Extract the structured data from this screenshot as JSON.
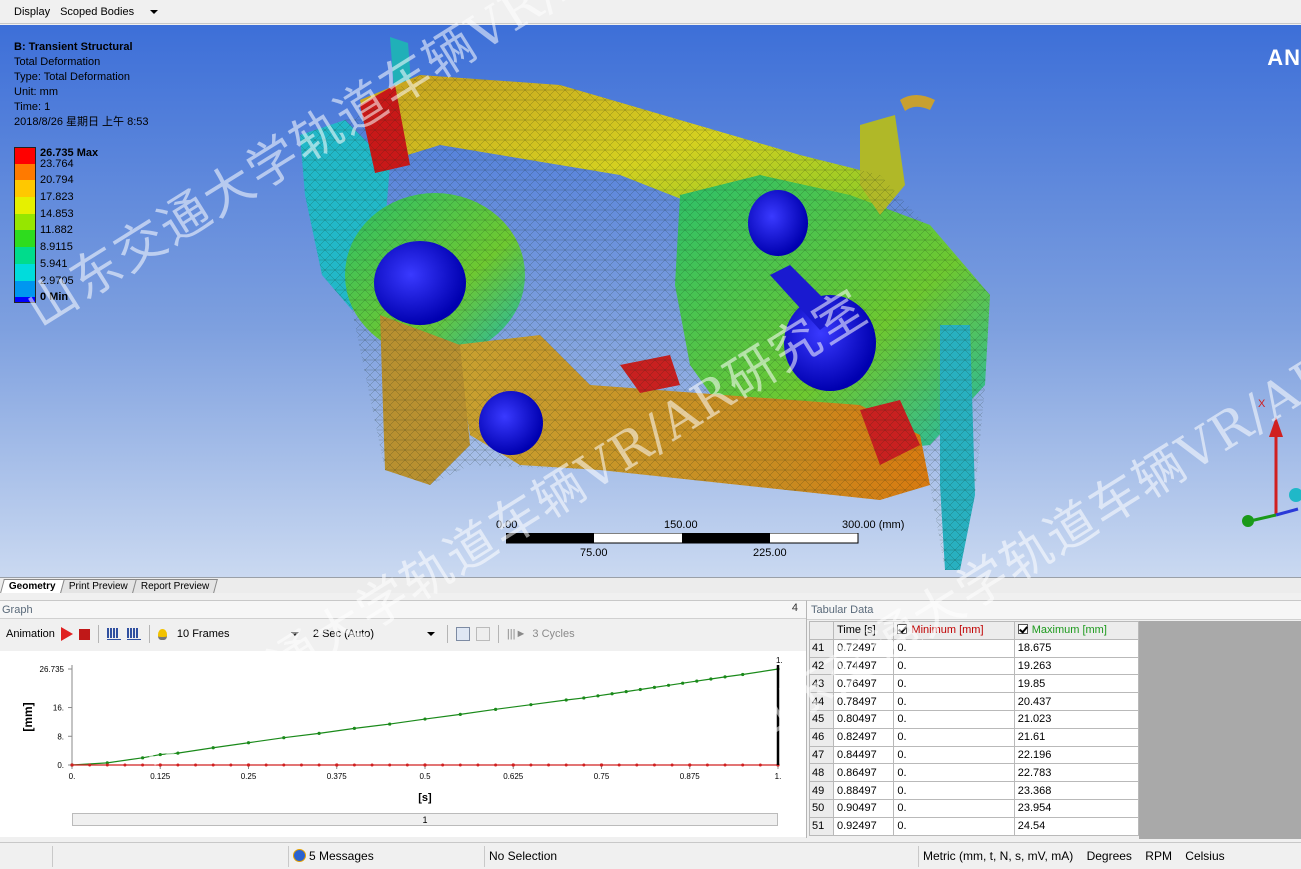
{
  "toolbar": {
    "display_label": "Display",
    "display_value": "Scoped Bodies"
  },
  "result": {
    "title": "B: Transient Structural",
    "lines": [
      "Total Deformation",
      "Type: Total Deformation",
      "Unit: mm",
      "Time: 1",
      "2018/8/26 星期日 上午 8:53"
    ]
  },
  "legend": {
    "entries": [
      {
        "label": "26.735 Max",
        "color": "#ff0000",
        "bold": true
      },
      {
        "label": "23.764",
        "color": "#ff7a00",
        "bold": false
      },
      {
        "label": "20.794",
        "color": "#ffc800",
        "bold": false
      },
      {
        "label": "17.823",
        "color": "#e6f000",
        "bold": false
      },
      {
        "label": "14.853",
        "color": "#96e600",
        "bold": false
      },
      {
        "label": "11.882",
        "color": "#2edc1e",
        "bold": false
      },
      {
        "label": "8.9115",
        "color": "#00dc8c",
        "bold": false
      },
      {
        "label": "5.941",
        "color": "#00dcdc",
        "bold": false
      },
      {
        "label": "2.9705",
        "color": "#0096f0",
        "bold": false
      },
      {
        "label": "0 Min",
        "color": "#0000ff",
        "bold": true
      }
    ]
  },
  "brand": "AN",
  "scale": {
    "top_left": "0.00",
    "top_mid": "150.00",
    "top_right": "300.00 (mm)",
    "bottom_left": "75.00",
    "bottom_right": "225.00"
  },
  "triad": {
    "x_label": "X"
  },
  "tabs": [
    {
      "label": "Geometry",
      "active": true
    },
    {
      "label": "Print Preview",
      "active": false
    },
    {
      "label": "Report Preview",
      "active": false
    }
  ],
  "graph": {
    "title": "Graph",
    "pin": "4",
    "animation_label": "Animation",
    "frames": "10 Frames",
    "duration": "2 Sec (Auto)",
    "cycles": "3 Cycles",
    "slider_label": "1"
  },
  "chart_data": {
    "type": "line",
    "title": "",
    "xlabel": "[s]",
    "ylabel": "[mm]",
    "xlim": [
      0,
      1
    ],
    "ylim": [
      0,
      26.735
    ],
    "x_ticks": [
      "0.",
      "0.125",
      "0.25",
      "0.375",
      "0.5",
      "0.625",
      "0.75",
      "0.875",
      "1."
    ],
    "y_ticks": [
      {
        "value": 0,
        "label": "0."
      },
      {
        "value": 8,
        "label": "8."
      },
      {
        "value": 16,
        "label": "16."
      },
      {
        "value": 26.735,
        "label": "26.735"
      }
    ],
    "cursor_label": "1.",
    "series": [
      {
        "color": "#1a8a1a",
        "x": [
          0,
          0.05,
          0.1,
          0.125,
          0.15,
          0.2,
          0.25,
          0.3,
          0.35,
          0.4,
          0.45,
          0.5,
          0.55,
          0.6,
          0.65,
          0.7,
          0.72497,
          0.74497,
          0.76497,
          0.78497,
          0.80497,
          0.82497,
          0.84497,
          0.86497,
          0.88497,
          0.90497,
          0.92497,
          0.95,
          1.0
        ],
        "y": [
          0,
          0.6,
          2.0,
          2.9,
          3.3,
          4.8,
          6.2,
          7.6,
          8.8,
          10.2,
          11.4,
          12.8,
          14.1,
          15.5,
          16.8,
          18.1,
          18.675,
          19.263,
          19.85,
          20.437,
          21.023,
          21.61,
          22.196,
          22.783,
          23.368,
          23.954,
          24.54,
          25.2,
          26.735
        ]
      },
      {
        "color": "#d02020",
        "x": [
          0,
          0.125,
          0.25,
          0.375,
          0.5,
          0.625,
          0.75,
          0.875,
          1.0
        ],
        "y": [
          0,
          0,
          0,
          0,
          0,
          0,
          0,
          0,
          0
        ]
      }
    ]
  },
  "tabular": {
    "title": "Tabular Data",
    "headers": {
      "time": "Time [s]",
      "min": "Minimum [mm]",
      "max": "Maximum [mm]"
    },
    "rows": [
      {
        "n": "41",
        "time": "0.72497",
        "min": "0.",
        "max": "18.675"
      },
      {
        "n": "42",
        "time": "0.74497",
        "min": "0.",
        "max": "19.263"
      },
      {
        "n": "43",
        "time": "0.76497",
        "min": "0.",
        "max": "19.85"
      },
      {
        "n": "44",
        "time": "0.78497",
        "min": "0.",
        "max": "20.437"
      },
      {
        "n": "45",
        "time": "0.80497",
        "min": "0.",
        "max": "21.023"
      },
      {
        "n": "46",
        "time": "0.82497",
        "min": "0.",
        "max": "21.61"
      },
      {
        "n": "47",
        "time": "0.84497",
        "min": "0.",
        "max": "22.196"
      },
      {
        "n": "48",
        "time": "0.86497",
        "min": "0.",
        "max": "22.783"
      },
      {
        "n": "49",
        "time": "0.88497",
        "min": "0.",
        "max": "23.368"
      },
      {
        "n": "50",
        "time": "0.90497",
        "min": "0.",
        "max": "23.954"
      },
      {
        "n": "51",
        "time": "0.92497",
        "min": "0.",
        "max": "24.54"
      }
    ]
  },
  "status": {
    "messages": "5 Messages",
    "selection": "No Selection",
    "units": "Metric (mm, t, N, s, mV, mA)",
    "angle": "Degrees",
    "rot": "RPM",
    "temp": "Celsius"
  },
  "watermarks": [
    "山东交通大学轨道车辆VR/AR研究室",
    "山东交通大学轨道车辆VR/AR研究室",
    "山东交通大学轨道车辆VR/AR研究室"
  ]
}
